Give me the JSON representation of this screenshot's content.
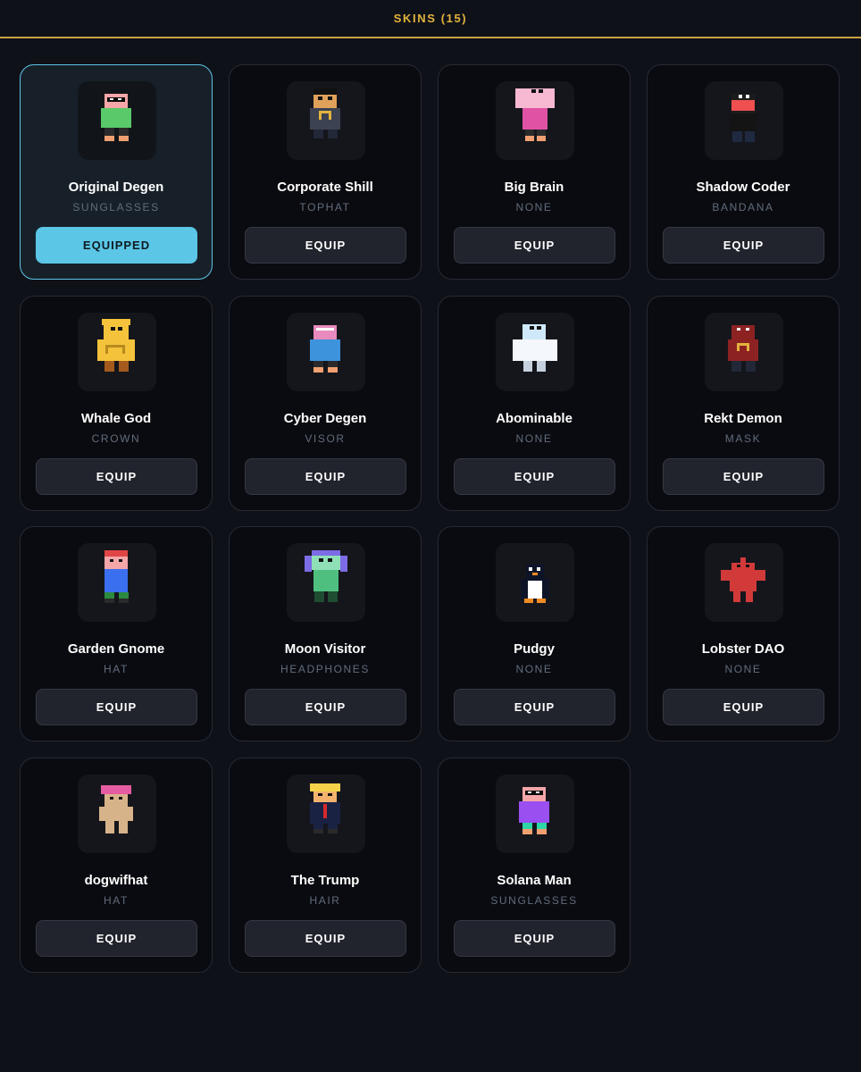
{
  "header": {
    "title": "SKINS (15)",
    "accent_color": "#e2b33c"
  },
  "labels": {
    "equip": "EQUIP",
    "equipped": "EQUIPPED"
  },
  "skins": [
    {
      "name": "Original Degen",
      "accessory": "SUNGLASSES",
      "equipped": true,
      "sprite": "original-degen-sprite"
    },
    {
      "name": "Corporate Shill",
      "accessory": "TOPHAT",
      "equipped": false,
      "sprite": "corporate-shill-sprite"
    },
    {
      "name": "Big Brain",
      "accessory": "NONE",
      "equipped": false,
      "sprite": "big-brain-sprite"
    },
    {
      "name": "Shadow Coder",
      "accessory": "BANDANA",
      "equipped": false,
      "sprite": "shadow-coder-sprite"
    },
    {
      "name": "Whale God",
      "accessory": "CROWN",
      "equipped": false,
      "sprite": "whale-god-sprite"
    },
    {
      "name": "Cyber Degen",
      "accessory": "VISOR",
      "equipped": false,
      "sprite": "cyber-degen-sprite"
    },
    {
      "name": "Abominable",
      "accessory": "NONE",
      "equipped": false,
      "sprite": "abominable-sprite"
    },
    {
      "name": "Rekt Demon",
      "accessory": "MASK",
      "equipped": false,
      "sprite": "rekt-demon-sprite"
    },
    {
      "name": "Garden Gnome",
      "accessory": "HAT",
      "equipped": false,
      "sprite": "garden-gnome-sprite"
    },
    {
      "name": "Moon Visitor",
      "accessory": "HEADPHONES",
      "equipped": false,
      "sprite": "moon-visitor-sprite"
    },
    {
      "name": "Pudgy",
      "accessory": "NONE",
      "equipped": false,
      "sprite": "pudgy-sprite"
    },
    {
      "name": "Lobster DAO",
      "accessory": "NONE",
      "equipped": false,
      "sprite": "lobster-dao-sprite"
    },
    {
      "name": "dogwifhat",
      "accessory": "HAT",
      "equipped": false,
      "sprite": "dogwifhat-sprite"
    },
    {
      "name": "The Trump",
      "accessory": "HAIR",
      "equipped": false,
      "sprite": "the-trump-sprite"
    },
    {
      "name": "Solana Man",
      "accessory": "SUNGLASSES",
      "equipped": false,
      "sprite": "solana-man-sprite"
    }
  ]
}
